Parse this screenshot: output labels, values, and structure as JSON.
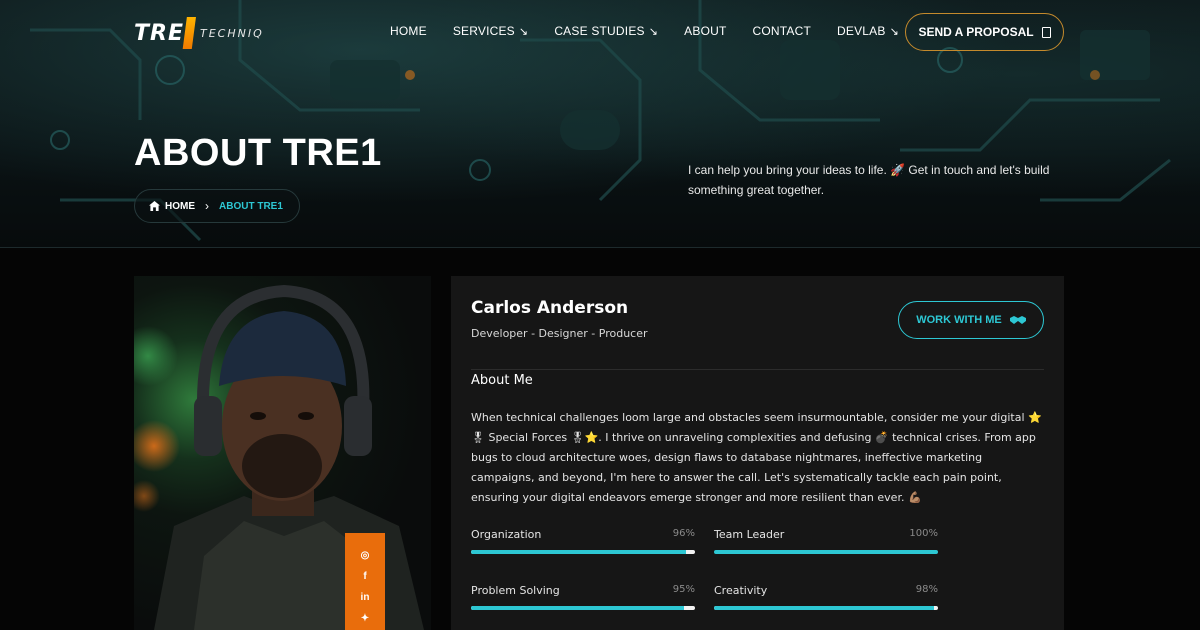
{
  "brand": {
    "logo_main": "TRE",
    "logo_sub": "TECHNIQ"
  },
  "nav": {
    "items": [
      {
        "label": "HOME",
        "has_arrow": false
      },
      {
        "label": "SERVICES",
        "has_arrow": true
      },
      {
        "label": "CASE STUDIES",
        "has_arrow": true
      },
      {
        "label": "ABOUT",
        "has_arrow": false
      },
      {
        "label": "CONTACT",
        "has_arrow": false
      },
      {
        "label": "DEVLAB",
        "has_arrow": true
      }
    ],
    "cta_label": "SEND A PROPOSAL"
  },
  "hero": {
    "title": "ABOUT TRE1",
    "tagline": "I can help you bring your ideas to life. 🚀 Get in touch and let's build something great together.",
    "breadcrumb": {
      "home": "HOME",
      "current": "ABOUT TRE1"
    }
  },
  "profile": {
    "name": "Carlos Anderson",
    "role": "Developer - Designer - Producer",
    "cta_label": "WORK WITH ME",
    "about_heading": "About Me",
    "bio": "When technical challenges loom large and obstacles seem insurmountable, consider me your digital ⭐🎖 Special Forces 🎖⭐. I thrive on unraveling complexities and defusing 💣 technical crises. From app bugs to cloud architecture woes, design flaws to database nightmares, ineffective marketing campaigns, and beyond, I'm here to answer the call. Let's systematically tackle each pain point, ensuring your digital endeavors emerge stronger and more resilient than ever. 💪🏽",
    "social": [
      "instagram-icon",
      "facebook-icon",
      "linkedin-icon",
      "twitter-icon"
    ]
  },
  "skills": [
    {
      "label": "Organization",
      "value": "96%",
      "percent": 96
    },
    {
      "label": "Team Leader",
      "value": "100%",
      "percent": 100
    },
    {
      "label": "Problem Solving",
      "value": "95%",
      "percent": 95
    },
    {
      "label": "Creativity",
      "value": "98%",
      "percent": 98
    }
  ],
  "colors": {
    "accent": "#2dc7d3",
    "orange": "#e96d0c",
    "proposal_border": "#c48a2c"
  }
}
